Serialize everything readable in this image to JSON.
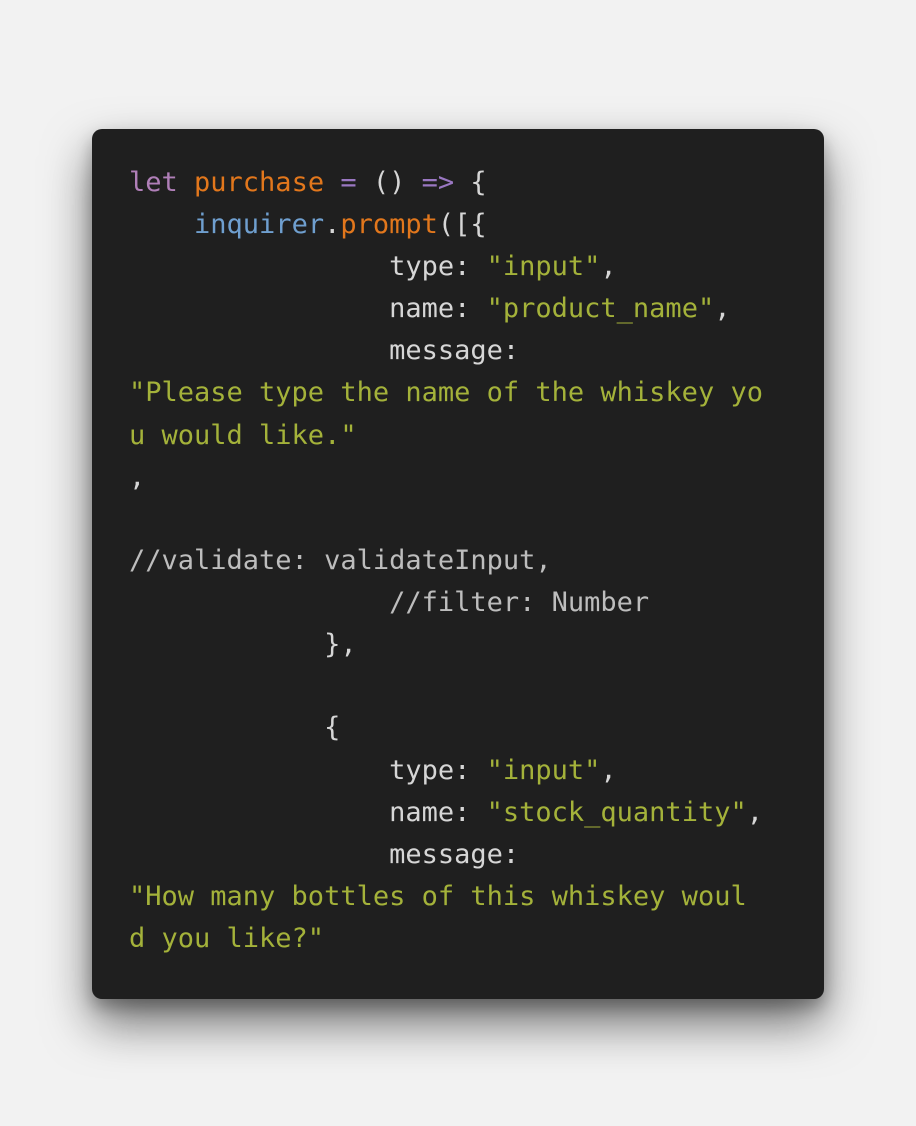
{
  "code": {
    "language": "javascript",
    "lines": [
      {
        "tokens": [
          {
            "text": "let ",
            "kind": "keyword"
          },
          {
            "text": "purchase",
            "kind": "name"
          },
          {
            "text": " = ",
            "kind": "op"
          },
          {
            "text": "() ",
            "kind": "default"
          },
          {
            "text": "=>",
            "kind": "op"
          },
          {
            "text": " {",
            "kind": "default"
          }
        ]
      },
      {
        "tokens": [
          {
            "text": "    ",
            "kind": "default"
          },
          {
            "text": "inquirer",
            "kind": "ident"
          },
          {
            "text": ".",
            "kind": "default"
          },
          {
            "text": "prompt",
            "kind": "name"
          },
          {
            "text": "([{",
            "kind": "default"
          }
        ]
      },
      {
        "tokens": [
          {
            "text": "                type: ",
            "kind": "default"
          },
          {
            "text": "\"input\"",
            "kind": "string"
          },
          {
            "text": ",",
            "kind": "default"
          }
        ]
      },
      {
        "tokens": [
          {
            "text": "                name: ",
            "kind": "default"
          },
          {
            "text": "\"product_name\"",
            "kind": "string"
          },
          {
            "text": ",",
            "kind": "default"
          }
        ]
      },
      {
        "tokens": [
          {
            "text": "                message:",
            "kind": "default"
          }
        ]
      },
      {
        "tokens": [
          {
            "text": "\"Please type the name of the whiskey yo",
            "kind": "string"
          }
        ]
      },
      {
        "tokens": [
          {
            "text": "u would like.\"",
            "kind": "string"
          }
        ]
      },
      {
        "tokens": [
          {
            "text": ",",
            "kind": "default"
          }
        ]
      },
      {
        "tokens": []
      },
      {
        "tokens": [
          {
            "text": "//validate: validateInput,",
            "kind": "comment"
          }
        ]
      },
      {
        "tokens": [
          {
            "text": "                //filter: Number",
            "kind": "comment"
          }
        ]
      },
      {
        "tokens": [
          {
            "text": "            },",
            "kind": "default"
          }
        ]
      },
      {
        "tokens": []
      },
      {
        "tokens": [
          {
            "text": "            {",
            "kind": "default"
          }
        ]
      },
      {
        "tokens": [
          {
            "text": "                type: ",
            "kind": "default"
          },
          {
            "text": "\"input\"",
            "kind": "string"
          },
          {
            "text": ",",
            "kind": "default"
          }
        ]
      },
      {
        "tokens": [
          {
            "text": "                name: ",
            "kind": "default"
          },
          {
            "text": "\"stock_quantity\"",
            "kind": "string"
          },
          {
            "text": ",",
            "kind": "default"
          }
        ]
      },
      {
        "tokens": [
          {
            "text": "                message:",
            "kind": "default"
          }
        ]
      },
      {
        "tokens": [
          {
            "text": "\"How many bottles of this whiskey woul",
            "kind": "string"
          }
        ]
      },
      {
        "tokens": [
          {
            "text": "d you like?\"",
            "kind": "string"
          }
        ]
      }
    ]
  },
  "colors": {
    "background": "#f2f2f2",
    "card": "#1f1f1f",
    "default": "#d6d6d6",
    "keyword": "#b07fb8",
    "name": "#e2771c",
    "op": "#9a77c2",
    "ident": "#6f9fcf",
    "string": "#a4b23a",
    "comment": "#bdbdbd"
  }
}
